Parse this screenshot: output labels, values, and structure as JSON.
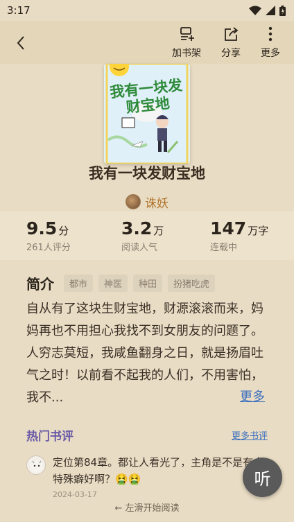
{
  "status_bar": {
    "time": "3:17"
  },
  "header": {
    "back_icon": "chevron-left-icon",
    "actions": [
      {
        "label": "加书架",
        "icon": "add-shelf-icon"
      },
      {
        "label": "分享",
        "icon": "share-icon"
      },
      {
        "label": "更多",
        "icon": "more-vertical-icon"
      }
    ]
  },
  "book": {
    "title": "我有一块发财宝地",
    "author": "诛妖",
    "cover_title": "我有一块发财宝地"
  },
  "stats": [
    {
      "value": "9.5",
      "unit": "分",
      "desc": "261人评分"
    },
    {
      "value": "3.2",
      "unit": "万",
      "desc": "阅读人气"
    },
    {
      "value": "147",
      "unit": "万字",
      "desc": "连载中"
    }
  ],
  "intro": {
    "title": "简介",
    "tags": [
      "都市",
      "神医",
      "种田",
      "扮猪吃虎"
    ],
    "text": "自从有了这块生财宝地，财源滚滚而来，妈妈再也不用担心我找不到女朋友的问题了。人穷志莫短，我咸鱼翻身之日，就是扬眉吐气之时！以前看不起我的人们，不用害怕，我不...",
    "more_label": "更多"
  },
  "reviews": {
    "title": "热门书评",
    "more_label": "更多书评",
    "items": [
      {
        "text": "定位第84章。都让人看光了，主角是不是有点特殊癖好啊？🤮🤮",
        "date": "2024-03-17"
      }
    ]
  },
  "listen_label": "听",
  "swipe_hint": "← 左滑开始阅读",
  "colors": {
    "background": "#e8dcc4",
    "accent_link": "#3b6fbf",
    "author": "#b0722a",
    "reviews_title": "#6a5aa8"
  }
}
